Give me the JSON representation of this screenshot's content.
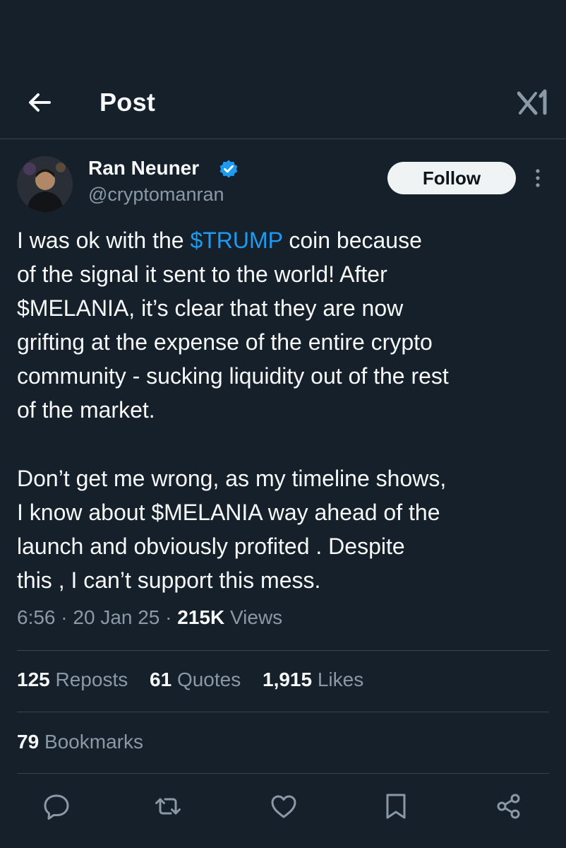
{
  "header": {
    "title": "Post"
  },
  "author": {
    "name": "Ran Neuner",
    "handle": "@cryptomanran",
    "follow_label": "Follow"
  },
  "post": {
    "paragraph1": {
      "before": "I was ok with the ",
      "cashtag": "$TRUMP",
      "after": " coin because\nof the signal it sent to the world! After\n$MELANIA, it’s clear that they are now\ngrifting at the expense of the entire crypto\ncommunity - sucking liquidity out of the rest\nof the market."
    },
    "paragraph2": "Don’t get me wrong, as my timeline shows,\nI know about $MELANIA way ahead of the\nlaunch and obviously profited . Despite\nthis , I can’t support this mess.",
    "time": "6:56",
    "date": "20 Jan 25",
    "views_count": "215K",
    "views_label": "Views",
    "separator": "·"
  },
  "stats": {
    "reposts_count": "125",
    "reposts_label": "Reposts",
    "quotes_count": "61",
    "quotes_label": "Quotes",
    "likes_count": "1,915",
    "likes_label": "Likes",
    "bookmarks_count": "79",
    "bookmarks_label": "Bookmarks"
  },
  "icons": {
    "back": "arrow-left-icon",
    "logo": "x-logo-icon",
    "verified": "verified-badge-icon",
    "more": "more-vertical-icon",
    "actions": [
      "reply-icon",
      "repost-icon",
      "like-icon",
      "bookmark-icon",
      "share-icon"
    ]
  },
  "colors": {
    "background": "#15202b",
    "text": "#f7f9f9",
    "secondary": "#8b98a5",
    "accent": "#1d9bf0",
    "border": "#38444d"
  }
}
